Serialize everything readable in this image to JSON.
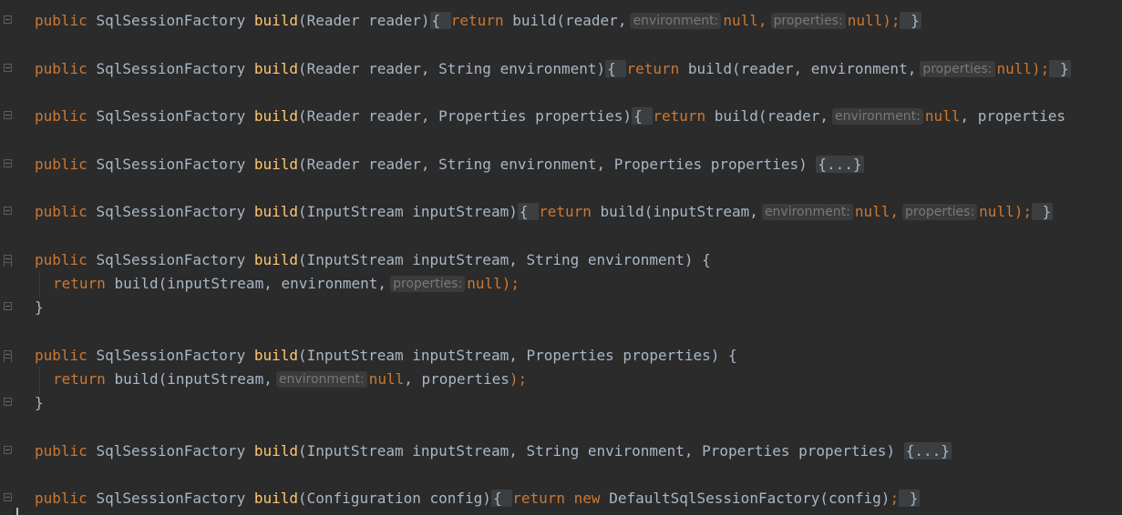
{
  "editor": {
    "keywords": {
      "public": "public",
      "return": "return",
      "new": "new",
      "null": "null"
    },
    "type": "SqlSessionFactory",
    "method": "build",
    "hints": {
      "environment": "environment:",
      "properties": "properties:"
    },
    "lines": {
      "l1": {
        "params": "(Reader reader)",
        "body_start": "{ ",
        "call": "build(reader,",
        "end": ");",
        "close": " }"
      },
      "l2": {
        "params": "(Reader reader, String environment)",
        "body_start": "{ ",
        "call": "build(reader, environment,",
        "end": ");",
        "close": " }"
      },
      "l3": {
        "params": "(Reader reader, Properties properties)",
        "body_start": "{ ",
        "call": "build(reader,",
        "tail": ", properties"
      },
      "l4": {
        "params": "(Reader reader, String environment, Properties properties)",
        "folded": "{...}"
      },
      "l5": {
        "params": "(InputStream inputStream)",
        "body_start": "{ ",
        "call": "build(inputStream,",
        "end": ");",
        "close": " }"
      },
      "l6": {
        "params": "(InputStream inputStream, String environment) {",
        "call": "build(inputStream, environment,",
        "end": ");",
        "close": "}"
      },
      "l7": {
        "params": "(InputStream inputStream, Properties properties) {",
        "call": "build(inputStream,",
        "tail": ", properties",
        "end": ");",
        "close": "}"
      },
      "l8": {
        "params": "(InputStream inputStream, String environment, Properties properties)",
        "folded": "{...}"
      },
      "l9": {
        "params": "(Configuration config)",
        "body_start": "{ ",
        "ctor": "DefaultSqlSessionFactory(config)",
        "end": ";",
        "close": " }"
      }
    }
  }
}
